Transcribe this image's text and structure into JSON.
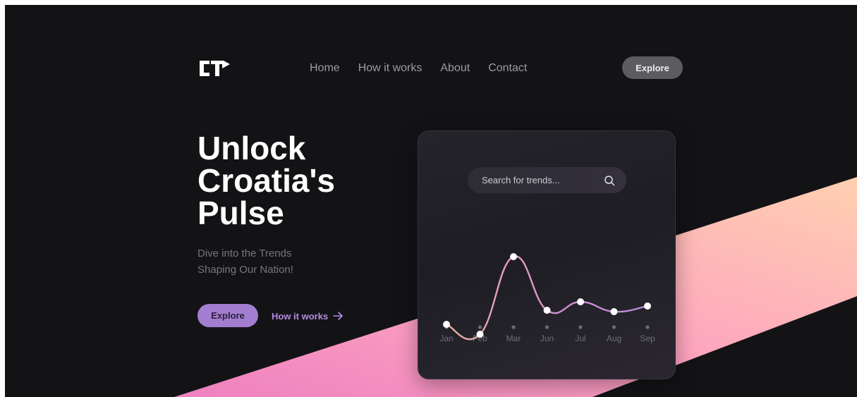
{
  "brand": {
    "logo_text": "CT",
    "accent_color": "#a37ed0",
    "link_color": "#b58be0"
  },
  "nav": {
    "items": [
      {
        "label": "Home"
      },
      {
        "label": "How it works"
      },
      {
        "label": "About"
      },
      {
        "label": "Contact"
      }
    ],
    "explore_label": "Explore"
  },
  "hero": {
    "title_lines": [
      "Unlock",
      "Croatia's",
      "Pulse"
    ],
    "subtitle_lines": [
      "Dive into the Trends",
      "Shaping Our Nation!"
    ],
    "explore_label": "Explore",
    "how_label": "How it works"
  },
  "search": {
    "placeholder": "Search for trends..."
  },
  "chart_data": {
    "type": "line",
    "categories": [
      "Jan",
      "Feb",
      "Mar",
      "Jun",
      "Jul",
      "Aug",
      "Sep"
    ],
    "values": [
      38,
      31,
      86,
      48,
      54,
      47,
      51
    ],
    "ylim": [
      0,
      100
    ],
    "grid": false,
    "line_gradient": [
      "#e0b39a",
      "#ea9bbf",
      "#c88fd6",
      "#b98bd8"
    ]
  },
  "icons": {
    "search": "search-icon",
    "arrow": "arrow-right-icon",
    "logo": "ct-logo-icon"
  }
}
